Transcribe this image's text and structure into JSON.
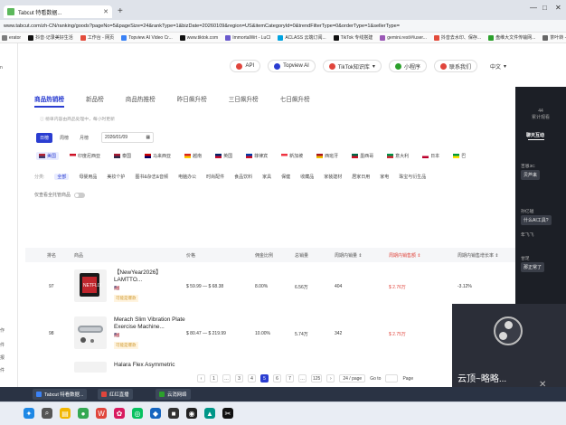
{
  "browser": {
    "tab_title": "Tabcut 特看数据...",
    "new_tab": "+",
    "url": "www.tabcut.com/zh-CN/ranking/goods?pageNo=5&pageSize=24&rankType=1&bizDate=20260109&region=US&itemCategoryId=0&trendFilterType=0&orderType=1&sellerType=",
    "window_controls": [
      "—",
      "□",
      "✕"
    ]
  },
  "bookmarks": [
    {
      "label": "erator",
      "color": "#7d7d7d"
    },
    {
      "label": "抖音·记录美好生活",
      "color": "#111111"
    },
    {
      "label": "工作台 - 网页",
      "color": "#e34c3c"
    },
    {
      "label": "Topview AI Video Cr...",
      "color": "#3b82f6"
    },
    {
      "label": "www.tiktok.com",
      "color": "#111111"
    },
    {
      "label": "ImmortalWrt - LuCI",
      "color": "#6a5acd"
    },
    {
      "label": "ACLASS 云端订阅...",
      "color": "#00a3e0"
    },
    {
      "label": "TikTok 专线搭建",
      "color": "#111111"
    },
    {
      "label": "gemini.rest/#/user...",
      "color": "#9b59b6"
    },
    {
      "label": "抖音去水印、保存...",
      "color": "#e34c3c"
    },
    {
      "label": "盘维大文件传输网...",
      "color": "#2ca02c"
    },
    {
      "label": "茶叶转 - 云...",
      "color": "#666666"
    }
  ],
  "left_strip": [
    "n",
    "作",
    "件",
    "报",
    "件"
  ],
  "top_nav": [
    {
      "label": "API",
      "color": "#e0453c"
    },
    {
      "label": "Topview AI",
      "color": "#2a3dd1"
    },
    {
      "label": "TikTok知识库",
      "color": "#e0453c",
      "suffix": "▾"
    },
    {
      "label": "小程序",
      "color": "#2ca02c"
    },
    {
      "label": "联系我们",
      "color": "#e0453c"
    },
    {
      "label": "中文",
      "color": "",
      "suffix": "▾"
    }
  ],
  "rank_tabs": [
    "商品热销榜",
    "新品榜",
    "商品热推榜",
    "昨日飙升榜",
    "三日飙升榜",
    "七日飙升榜"
  ],
  "note": "ⓘ 榜单内容由商品处理中，每小时更新",
  "periods": [
    "日榜",
    "周榜",
    "月榜"
  ],
  "date": "2026/01/09",
  "regions": [
    {
      "label": "美国",
      "colors": [
        "#b22234",
        "#3c3b6e"
      ],
      "active": true
    },
    {
      "label": "印度尼西亚",
      "colors": [
        "#ce1126",
        "#ffffff"
      ]
    },
    {
      "label": "泰国",
      "colors": [
        "#a51931",
        "#2d2a4a"
      ]
    },
    {
      "label": "马来西亚",
      "colors": [
        "#cc0001",
        "#010066"
      ]
    },
    {
      "label": "越南",
      "colors": [
        "#da251d",
        "#ffcd00"
      ]
    },
    {
      "label": "英国",
      "colors": [
        "#012169",
        "#c8102e"
      ]
    },
    {
      "label": "菲律宾",
      "colors": [
        "#0038a8",
        "#ce1126"
      ]
    },
    {
      "label": "新加坡",
      "colors": [
        "#ef3340",
        "#ffffff"
      ]
    },
    {
      "label": "西班牙",
      "colors": [
        "#aa151b",
        "#f1bf00"
      ]
    },
    {
      "label": "墨西哥",
      "colors": [
        "#006847",
        "#ce1126"
      ]
    },
    {
      "label": "意大利",
      "colors": [
        "#009246",
        "#ce2b37"
      ]
    },
    {
      "label": "日本",
      "colors": [
        "#ffffff",
        "#bc002d"
      ]
    },
    {
      "label": "巴",
      "colors": [
        "#009c3b",
        "#ffdf00"
      ]
    }
  ],
  "categories_label": "分类:",
  "categories": [
    "全部",
    "母婴用品",
    "美妆个护",
    "图书&杂志&音频",
    "电脑办公",
    "时尚配件",
    "食品饮料",
    "家具",
    "保健",
    "收藏品",
    "家装建材",
    "居家日用",
    "家电",
    "珠宝与衍生品"
  ],
  "filter_label": "仅查看全托管商品",
  "table": {
    "headers": [
      "排名",
      "商品",
      "价格",
      "佣金比例",
      "总销量",
      "周期内销量 ⇕",
      "周期内销售额 ⇕",
      "周期内销售增长率 ⇕"
    ],
    "rows": [
      {
        "rank": "97",
        "name": "【NewYear2026】LAMTTO...",
        "flag": "🇺🇸",
        "tag": "可能是爆款",
        "price": "$ 59.99 — $ 68.38",
        "commission": "8.00%",
        "total_sales": "6.56万",
        "period_sales": "404",
        "period_revenue": "$ 2.76万",
        "growth": "-3.12%"
      },
      {
        "rank": "98",
        "name": "Merach Slim Vibration Plate Exercise Machine...",
        "flag": "🇺🇸",
        "tag": "可能是爆款",
        "price": "$ 80.47 — $ 219.99",
        "commission": "10.00%",
        "total_sales": "5.74万",
        "period_sales": "342",
        "period_revenue": "$ 2.75万",
        "growth": ""
      },
      {
        "rank": "",
        "name": "Halara Flex Asymmetric",
        "flag": "",
        "tag": "",
        "price": "",
        "commission": "",
        "total_sales": "",
        "period_sales": "",
        "period_revenue": "",
        "growth": ""
      }
    ]
  },
  "pager": {
    "prev": "‹",
    "pages": [
      "1",
      "…",
      "3",
      "4",
      "5",
      "6",
      "7",
      "…",
      "125"
    ],
    "active": "5",
    "next": "›",
    "size": "24 / page",
    "goto": "Go to",
    "page_word": "Page"
  },
  "chat": {
    "header": "44\n累计观看",
    "tab": "聊天互动",
    "messages": [
      {
        "user": "吉恩3C",
        "text": "贝芦来"
      },
      {
        "user": "孙亿碰",
        "text": "什么AI工具?"
      },
      {
        "user": "年飞飞",
        "text": ""
      },
      {
        "user": "甘足",
        "text": "那正常了"
      }
    ]
  },
  "obs": {
    "caption": "云顶~略略...",
    "cam_icon": "✕"
  },
  "panel_apps": [
    {
      "label": "Tabcut 特看数据...",
      "color": "#3b82f6"
    },
    {
      "label": "红红直播",
      "color": "#e0453c"
    },
    {
      "label": "云消网络",
      "color": "#2ca02c"
    }
  ],
  "taskbar_icons": [
    {
      "name": "start",
      "color": "#1e88e5",
      "glyph": "✦"
    },
    {
      "name": "search",
      "color": "#555555",
      "glyph": "⌕"
    },
    {
      "name": "explorer",
      "color": "#f2b600",
      "glyph": "▤"
    },
    {
      "name": "chrome",
      "color": "#34a853",
      "glyph": "●"
    },
    {
      "name": "wps",
      "color": "#e0453c",
      "glyph": "W"
    },
    {
      "name": "app-red",
      "color": "#d81b60",
      "glyph": "✿"
    },
    {
      "name": "wechat",
      "color": "#07c160",
      "glyph": "◎"
    },
    {
      "name": "app-blue",
      "color": "#1565c0",
      "glyph": "◆"
    },
    {
      "name": "app-dark",
      "color": "#333333",
      "glyph": "■"
    },
    {
      "name": "obs",
      "color": "#222222",
      "glyph": "◉"
    },
    {
      "name": "app-teal",
      "color": "#009688",
      "glyph": "▲"
    },
    {
      "name": "capcut",
      "color": "#111111",
      "glyph": "✂"
    }
  ]
}
